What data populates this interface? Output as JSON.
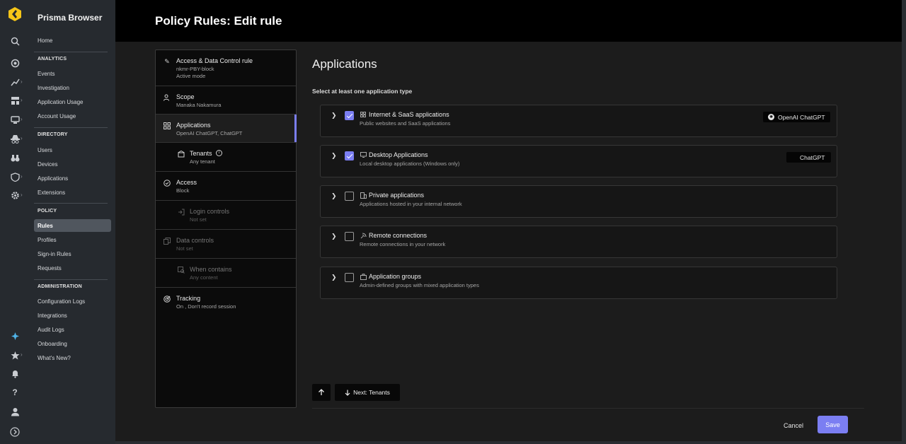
{
  "app": {
    "brand": "Prisma Browser"
  },
  "header": {
    "title": "Policy Rules: Edit rule"
  },
  "rail": {
    "icons": [
      "prisma-logo",
      "search-icon",
      "dashboard-icon",
      "analytics-icon",
      "widgets-icon",
      "devices-icon",
      "incognito-icon",
      "binoculars-icon",
      "shield-search-icon",
      "gear-icon",
      "sparkle-icon",
      "star-icon",
      "bell-icon",
      "help-icon",
      "user-icon",
      "expand-icon"
    ]
  },
  "sidebar": {
    "home": "Home",
    "analytics": {
      "heading": "ANALYTICS",
      "items": [
        "Events",
        "Investigation",
        "Application Usage",
        "Account Usage"
      ]
    },
    "directory": {
      "heading": "DIRECTORY",
      "items": [
        "Users",
        "Devices",
        "Applications",
        "Extensions"
      ]
    },
    "policy": {
      "heading": "POLICY",
      "items": [
        "Rules",
        "Profiles",
        "Sign-in Rules",
        "Requests"
      ]
    },
    "administration": {
      "heading": "ADMINISTRATION",
      "items": [
        "Configuration Logs",
        "Integrations",
        "Audit Logs",
        "Onboarding",
        "What's New?"
      ]
    }
  },
  "steps": [
    {
      "title": "Access & Data Control rule",
      "sub": "nkmr-PBY-block",
      "sub2": "Active mode"
    },
    {
      "title": "Scope",
      "sub": "Manaka Nakamura"
    },
    {
      "title": "Applications",
      "sub": "OpenAI ChatGPT, ChatGPT"
    },
    {
      "title": "Tenants",
      "sub": "Any tenant"
    },
    {
      "title": "Access",
      "sub": "Block"
    },
    {
      "title": "Login controls",
      "sub": "Not set"
    },
    {
      "title": "Data controls",
      "sub": "Not set"
    },
    {
      "title": "When contains",
      "sub": "Any content"
    },
    {
      "title": "Tracking",
      "sub": "On , Don't record session"
    }
  ],
  "content": {
    "title": "Applications",
    "subtitle": "Select at least one application type",
    "cards": [
      {
        "title": "Internet & SaaS applications",
        "sub": "Public websites and SaaS applications",
        "checked": true,
        "tag": "OpenAI ChatGPT"
      },
      {
        "title": "Desktop Applications",
        "sub": "Local desktop applications (Windows only)",
        "checked": true,
        "tag": "ChatGPT"
      },
      {
        "title": "Private applications",
        "sub": "Applications hosted in your internal network",
        "checked": false
      },
      {
        "title": "Remote connections",
        "sub": "Remote connections in your network",
        "checked": false
      },
      {
        "title": "Application groups",
        "sub": "Admin-defined groups with mixed application types",
        "checked": false
      }
    ],
    "next_label": "Next: Tenants"
  },
  "footer": {
    "cancel": "Cancel",
    "save": "Save"
  },
  "colors": {
    "accent": "#7b7ef2",
    "logo": "#f5c518"
  }
}
